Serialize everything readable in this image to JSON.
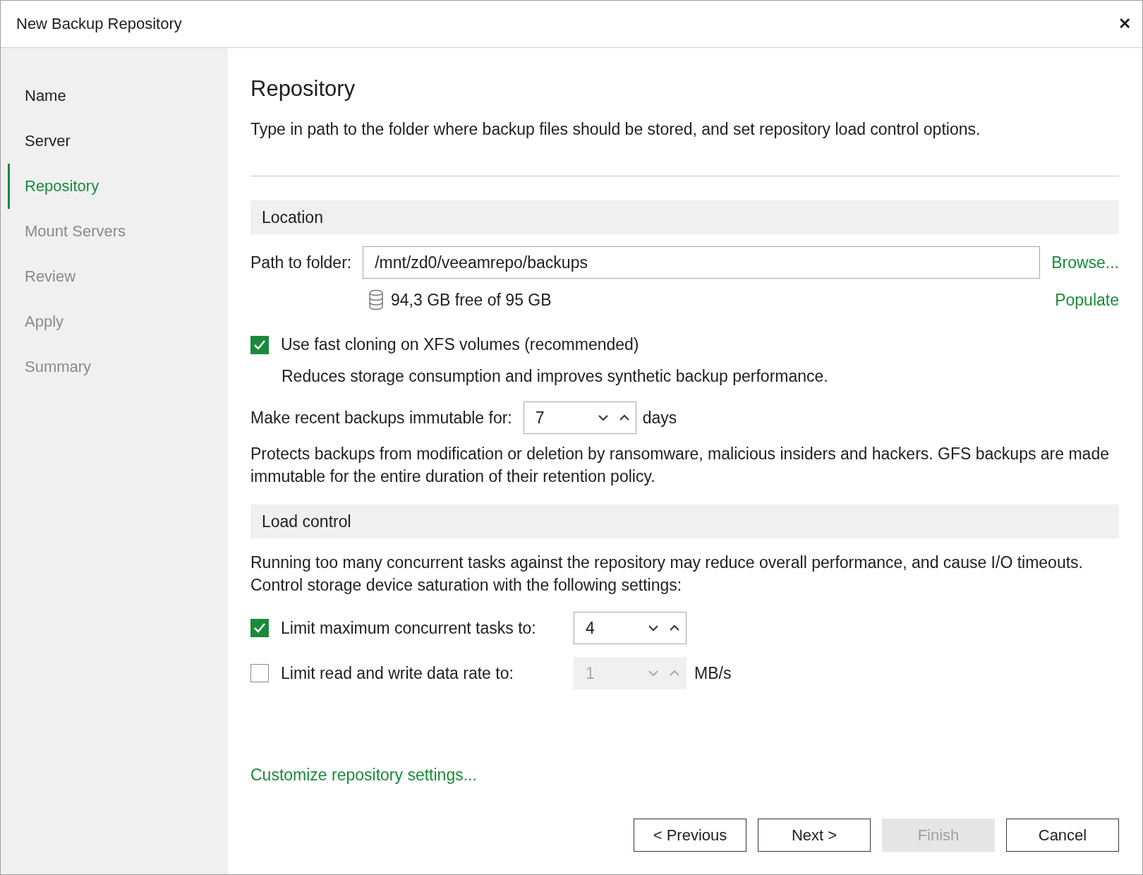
{
  "window": {
    "title": "New Backup Repository",
    "close": "✕"
  },
  "steps": [
    {
      "label": "Name",
      "selected": false,
      "enabled": true
    },
    {
      "label": "Server",
      "selected": false,
      "enabled": true
    },
    {
      "label": "Repository",
      "selected": true,
      "enabled": true
    },
    {
      "label": "Mount Servers",
      "selected": false,
      "enabled": false
    },
    {
      "label": "Review",
      "selected": false,
      "enabled": false
    },
    {
      "label": "Apply",
      "selected": false,
      "enabled": false
    },
    {
      "label": "Summary",
      "selected": false,
      "enabled": false
    }
  ],
  "heading": "Repository",
  "description": "Type in path to the folder where backup files should be stored, and set repository load control options.",
  "location": {
    "title": "Location",
    "path_label": "Path to folder:",
    "path_value": "/mnt/zd0/veeamrepo/backups",
    "browse": "Browse...",
    "free_space": "94,3 GB free of 95 GB",
    "populate": "Populate",
    "fast_clone": {
      "label": "Use fast cloning on XFS volumes (recommended)",
      "checked": true,
      "hint": "Reduces storage consumption and improves synthetic backup performance."
    },
    "immutable": {
      "label": "Make recent backups immutable for:",
      "value": "7",
      "unit": "days",
      "disabled": false
    },
    "immutable_note": "Protects backups from modification or deletion by ransomware, malicious insiders and hackers. GFS backups are made immutable for the entire duration of their retention policy."
  },
  "load_control": {
    "title": "Load control",
    "note": "Running too many concurrent tasks against the repository may reduce overall performance, and cause I/O timeouts. Control storage device saturation with the following settings:",
    "options": [
      {
        "label": "Limit maximum concurrent tasks to:",
        "checked": true,
        "value": "4"
      },
      {
        "label": "Limit read and write data rate to:",
        "checked": false,
        "value": "1",
        "unit": "MB/s"
      }
    ]
  },
  "customize_link": "Customize repository settings...",
  "buttons": [
    {
      "label": "< Previous",
      "disabled": false
    },
    {
      "label": "Next >",
      "disabled": false
    },
    {
      "label": "Finish",
      "disabled": true
    },
    {
      "label": "Cancel",
      "disabled": false
    }
  ]
}
